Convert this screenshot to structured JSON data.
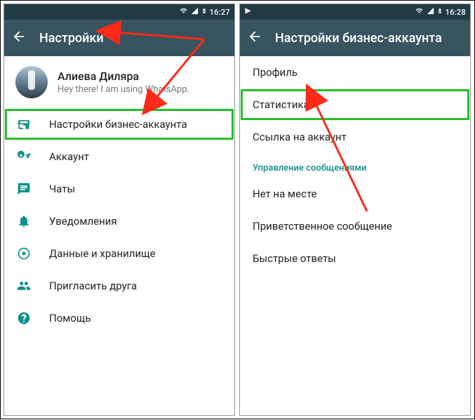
{
  "left": {
    "statusbar": {
      "time": "16:27"
    },
    "appbar": {
      "title": "Настройки"
    },
    "profile": {
      "name": "Алиева Диляра",
      "status": "Hey there! I am using WhatsApp."
    },
    "items": [
      {
        "icon": "storefront",
        "label": "Настройки бизнес-аккаунта"
      },
      {
        "icon": "key",
        "label": "Аккаунт"
      },
      {
        "icon": "chat",
        "label": "Чаты"
      },
      {
        "icon": "bell",
        "label": "Уведомления"
      },
      {
        "icon": "data",
        "label": "Данные и хранилище"
      },
      {
        "icon": "invite",
        "label": "Пригласить друга"
      },
      {
        "icon": "help",
        "label": "Помощь"
      }
    ]
  },
  "right": {
    "statusbar": {
      "time": "16:28"
    },
    "appbar": {
      "title": "Настройки бизнес-аккаунта"
    },
    "items": [
      {
        "label": "Профиль"
      },
      {
        "label": "Статистика"
      },
      {
        "label": "Ссылка на аккаунт"
      }
    ],
    "section_header": "Управление сообщениями",
    "section_items": [
      {
        "label": "Нет на месте"
      },
      {
        "label": "Приветственное сообщение"
      },
      {
        "label": "Быстрые ответы"
      }
    ]
  },
  "colors": {
    "statusbar": "#223b44",
    "appbar": "#37545f",
    "accent": "#0f9188",
    "highlight": "#22c02a",
    "arrow": "#ff2a1a"
  }
}
